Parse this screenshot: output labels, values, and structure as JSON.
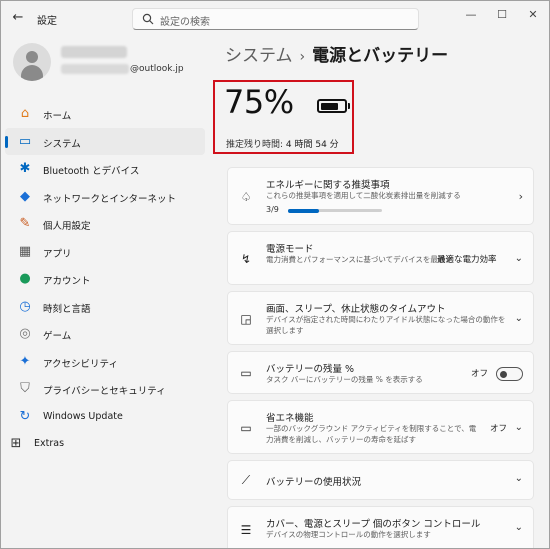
{
  "window": {
    "title": "設定",
    "controls": {
      "minimize": "—",
      "maximize": "☐",
      "close": "✕"
    },
    "back": "←"
  },
  "search": {
    "placeholder": "設定の検索"
  },
  "user": {
    "email_suffix": "@outlook.jp"
  },
  "nav": {
    "items": [
      {
        "label": "ホーム",
        "icon": "home-icon",
        "glyph": "⌂",
        "color": "#e07b1a"
      },
      {
        "label": "システム",
        "icon": "monitor-icon",
        "glyph": "▭",
        "color": "#0067c0",
        "active": true
      },
      {
        "label": "Bluetooth とデバイス",
        "icon": "bluetooth-icon",
        "glyph": "✱",
        "color": "#0067c0"
      },
      {
        "label": "ネットワークとインターネット",
        "icon": "wifi-icon",
        "glyph": "◆",
        "color": "#1a6fd6"
      },
      {
        "label": "個人用設定",
        "icon": "paintbrush-icon",
        "glyph": "✎",
        "color": "#c85a1e"
      },
      {
        "label": "アプリ",
        "icon": "apps-icon",
        "glyph": "▦",
        "color": "#555555"
      },
      {
        "label": "アカウント",
        "icon": "person-icon",
        "glyph": "●",
        "color": "#1a9a5a"
      },
      {
        "label": "時刻と言語",
        "icon": "globe-clock-icon",
        "glyph": "◷",
        "color": "#1a6fd6"
      },
      {
        "label": "ゲーム",
        "icon": "gamepad-icon",
        "glyph": "◎",
        "color": "#777777"
      },
      {
        "label": "アクセシビリティ",
        "icon": "accessibility-icon",
        "glyph": "✦",
        "color": "#1a6fd6"
      },
      {
        "label": "プライバシーとセキュリティ",
        "icon": "shield-icon",
        "glyph": "⛉",
        "color": "#666666"
      },
      {
        "label": "Windows Update",
        "icon": "update-icon",
        "glyph": "↻",
        "color": "#1a6fd6"
      },
      {
        "label": "Extras",
        "icon": "extras-icon",
        "glyph": "⊞",
        "color": "#333333",
        "sub": true
      }
    ]
  },
  "breadcrumb": {
    "parent": "システム",
    "separator": "›",
    "current": "電源とバッテリー"
  },
  "battery": {
    "percent_text": "75%",
    "level": 0.75,
    "remaining_label": "推定残り時間:",
    "remaining_value": "4 時間 54 分"
  },
  "cards": {
    "energy": {
      "title": "エネルギーに関する推奨事項",
      "desc": "これらの推奨事項を適用して二酸化炭素排出量を削減する",
      "progress_text": "3/9",
      "progress": 0.333,
      "icon": "leaf-icon",
      "glyph": "♤"
    },
    "power_mode": {
      "title": "電源モード",
      "desc": "電力消費とパフォーマンスに基づいてデバイスを最適化",
      "value": "最適な電力効率",
      "icon": "power-mode-icon",
      "glyph": "↯"
    },
    "screen_sleep": {
      "title": "画面、スリープ、休止状態のタイムアウト",
      "desc": "デバイスが指定された時間にわたりアイドル状態になった場合の動作を選択します",
      "icon": "screen-sleep-icon",
      "glyph": "◲"
    },
    "battery_percent": {
      "title": "バッテリーの残量 %",
      "desc": "タスク バーにバッテリーの残量 % を表示する",
      "value": "オフ",
      "icon": "battery-charge-icon",
      "glyph": "▭"
    },
    "energy_saver": {
      "title": "省エネ機能",
      "desc": "一部のバックグラウンド アクティビティを制限することで、電力消費を削減し、バッテリーの寿命を延ばす",
      "value": "オフ",
      "icon": "energy-saver-icon",
      "glyph": "▭"
    },
    "battery_usage": {
      "title": "バッテリーの使用状況",
      "icon": "chart-icon",
      "glyph": "⟋"
    },
    "buttons": {
      "title": "カバー、電源とスリープ 個のボタン コントロール",
      "desc": "デバイスの物理コントロールの動作を選択します",
      "icon": "button-controls-icon",
      "glyph": "☰"
    }
  }
}
